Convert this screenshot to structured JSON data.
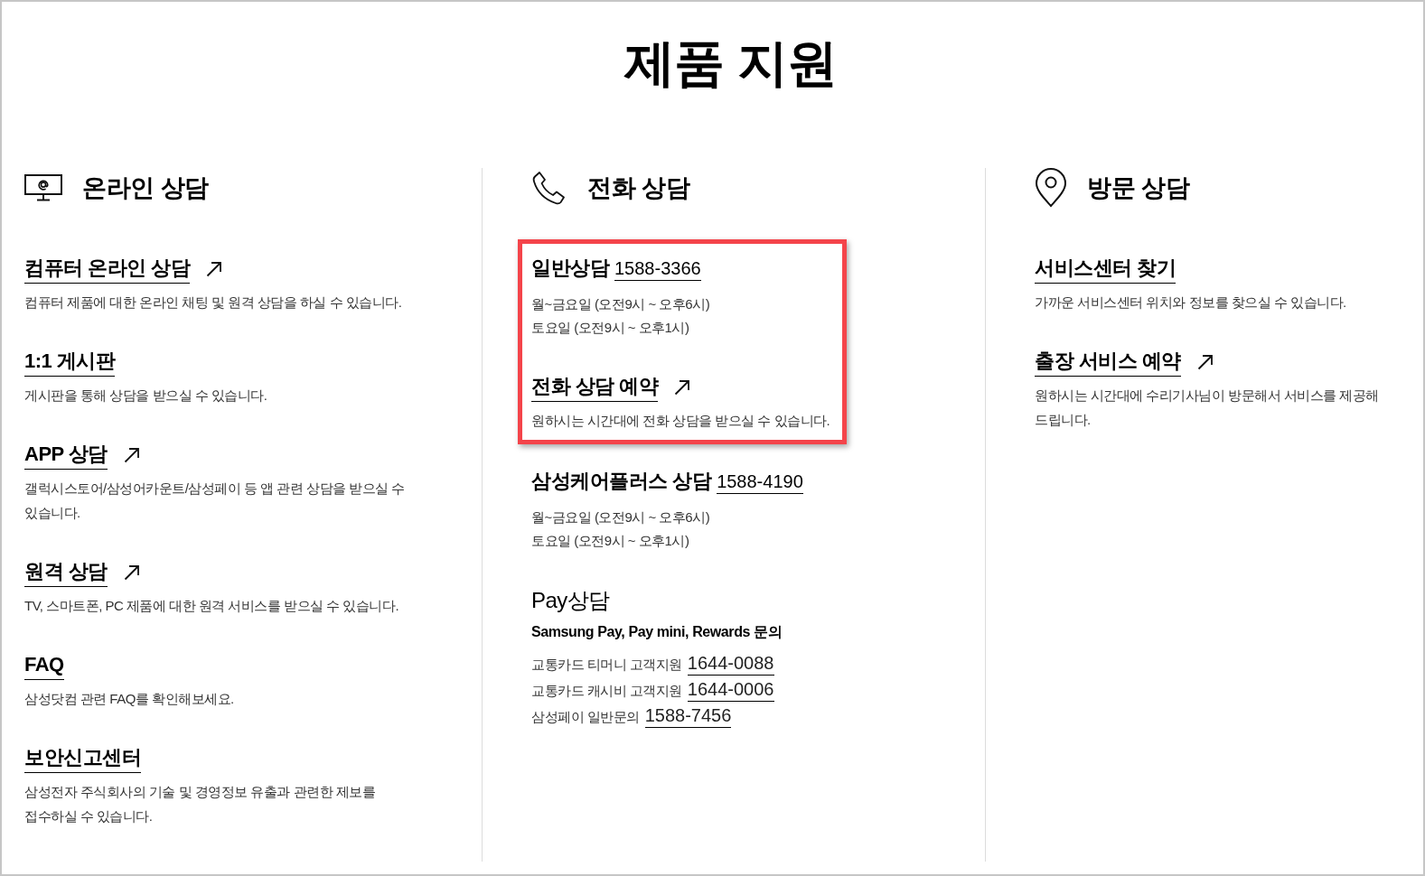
{
  "page": {
    "title": "제품 지원"
  },
  "columns": [
    {
      "heading": "온라인 상담",
      "items": [
        {
          "kind": "link",
          "title": "컴퓨터 온라인 상담",
          "external": true,
          "description": "컴퓨터 제품에 대한 온라인 채팅 및 원격 상담을 하실 수 있습니다.",
          "highlighted": false
        },
        {
          "kind": "link",
          "title": "1:1 게시판",
          "external": false,
          "description": "게시판을 통해 상담을 받으실 수 있습니다.",
          "highlighted": false
        },
        {
          "kind": "link",
          "title": "APP 상담",
          "external": true,
          "description": "갤럭시스토어/삼성어카운트/삼성페이 등 앱 관련 상담을 받으실 수 있습니다.",
          "highlighted": false
        },
        {
          "kind": "link",
          "title": "원격 상담",
          "external": true,
          "description": "TV, 스마트폰, PC 제품에 대한 원격 서비스를 받으실 수 있습니다.",
          "highlighted": false
        },
        {
          "kind": "link",
          "title": "FAQ",
          "external": false,
          "description": "삼성닷컴 관련 FAQ를 확인해보세요.",
          "highlighted": false
        },
        {
          "kind": "link",
          "title": "보안신고센터",
          "external": false,
          "description": "삼성전자 주식회사의 기술 및 경영정보 유출과 관련한 제보를 접수하실 수 있습니다.",
          "highlighted": false
        }
      ]
    },
    {
      "heading": "전화 상담",
      "items": [
        {
          "kind": "hotline",
          "title": "일반상담",
          "number": "1588-3366",
          "hours": [
            "월~금요일 (오전9시 ~ 오후6시)",
            "토요일 (오전9시 ~ 오후1시)"
          ],
          "highlighted": true
        },
        {
          "kind": "link",
          "title": "전화 상담 예약",
          "external": true,
          "description": "원하시는 시간대에 전화 상담을 받으실 수 있습니다.",
          "highlighted": true
        },
        {
          "kind": "hotline",
          "title": "삼성케어플러스 상담",
          "number": "1588-4190",
          "hours": [
            "월~금요일 (오전9시 ~ 오후6시)",
            "토요일 (오전9시 ~ 오후1시)"
          ],
          "highlighted": false
        },
        {
          "kind": "pay",
          "title": "Pay상담",
          "subtitle": "Samsung Pay, Pay mini, Rewards 문의",
          "lines": [
            {
              "label": "교통카드 티머니 고객지원",
              "number": "1644-0088"
            },
            {
              "label": "교통카드 캐시비 고객지원",
              "number": "1644-0006"
            },
            {
              "label": "삼성페이 일반문의",
              "number": "1588-7456"
            }
          ],
          "highlighted": false
        }
      ]
    },
    {
      "heading": "방문 상담",
      "items": [
        {
          "kind": "link",
          "title": "서비스센터 찾기",
          "external": false,
          "description": "가까운 서비스센터 위치와 정보를 찾으실 수 있습니다.",
          "highlighted": false
        },
        {
          "kind": "link",
          "title": "출장 서비스 예약",
          "external": true,
          "description": "원하시는 시간대에 수리기사님이 방문해서 서비스를 제공해 드립니다.",
          "highlighted": false
        }
      ]
    }
  ]
}
